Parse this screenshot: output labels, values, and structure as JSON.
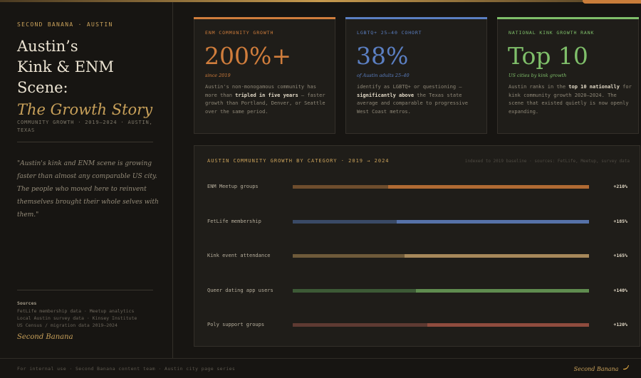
{
  "sidebar": {
    "brand": "SECOND BANANA · AUSTIN",
    "title_lines": [
      "Austin’s",
      "Kink & ENM",
      "Scene:"
    ],
    "title_accent": "The Growth Story",
    "subtitle": "COMMUNITY GROWTH · 2019–2024 · AUSTIN, TEXAS",
    "quote": "\"Austin's kink and ENM scene is growing faster than almost any comparable US city. The people who moved here to reinvent themselves brought their whole selves with them.\"",
    "sources_heading": "Sources",
    "sources": [
      "FetLife membership data · Meetup analytics",
      "Local Austin survey data · Kinsey Institute",
      "US Census / migration data 2019–2024"
    ],
    "signature": "Second Banana"
  },
  "cards": [
    {
      "label": "ENM COMMUNITY GROWTH",
      "value": "200%+",
      "caption": "since 2019",
      "color": "#d07d3c",
      "body_parts": [
        {
          "t": "Austin's non-monogamous community has more than ",
          "b": false
        },
        {
          "t": "tripled in five years",
          "b": true
        },
        {
          "t": " — faster growth than Portland, Denver, or Seattle over the same period.",
          "b": false
        }
      ]
    },
    {
      "label": "LGBTQ+ 25–40 COHORT",
      "value": "38%",
      "caption": "of Austin adults 25–40",
      "color": "#5b7fc2",
      "body_parts": [
        {
          "t": "identify as LGBTQ+ or questioning — ",
          "b": false
        },
        {
          "t": "significantly above",
          "b": true
        },
        {
          "t": " the Texas state average and comparable to progressive West Coast metros.",
          "b": false
        }
      ]
    },
    {
      "label": "NATIONAL KINK GROWTH RANK",
      "value": "Top 10",
      "caption": "US cities by kink growth",
      "color": "#7fbf6a",
      "body_parts": [
        {
          "t": "Austin ranks in the ",
          "b": false
        },
        {
          "t": "top 10 nationally",
          "b": true
        },
        {
          "t": " for kink community growth 2020–2024. The scene that existed quietly is now openly expanding.",
          "b": false
        }
      ]
    }
  ],
  "growth": {
    "title": "AUSTIN COMMUNITY GROWTH BY CATEGORY · 2019 → 2024",
    "note": "indexed to 2019 baseline · sources: FetLife, Meetup, survey data",
    "rows": [
      {
        "label": "ENM Meetup groups",
        "value_label": "+210%",
        "growth_pct": 210,
        "base_color": "#6e4d2d",
        "growth_color": "#b06a33"
      },
      {
        "label": "FetLife membership",
        "value_label": "+185%",
        "growth_pct": 185,
        "base_color": "#3a4a66",
        "growth_color": "#5672a8"
      },
      {
        "label": "Kink event attendance",
        "value_label": "+165%",
        "growth_pct": 165,
        "base_color": "#6e5a3a",
        "growth_color": "#a6885a"
      },
      {
        "label": "Queer dating app users",
        "value_label": "+140%",
        "growth_pct": 140,
        "base_color": "#3d5a36",
        "growth_color": "#5f8c4f"
      },
      {
        "label": "Poly support groups",
        "value_label": "+120%",
        "growth_pct": 120,
        "base_color": "#5e3a32",
        "growth_color": "#8f4c3e"
      }
    ]
  },
  "footer": {
    "left": "For internal use · Second Banana content team · Austin city page series",
    "right": "Second Banana",
    "icon": "banana-icon"
  }
}
